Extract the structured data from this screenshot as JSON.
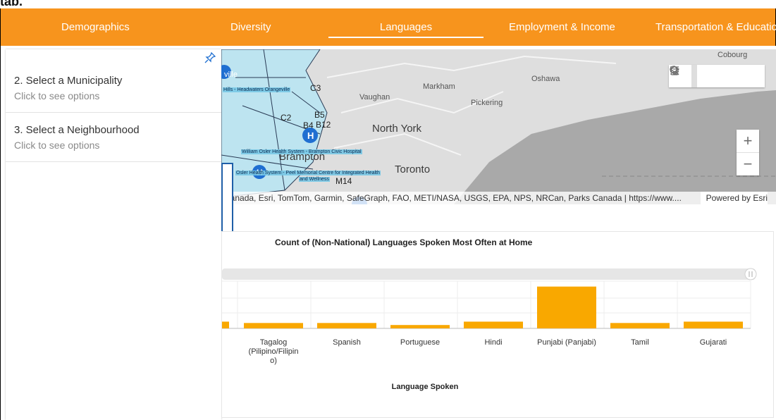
{
  "top_strip": {
    "text": "tab."
  },
  "tabs": [
    {
      "label": "Demographics",
      "active": false
    },
    {
      "label": "Diversity",
      "active": false
    },
    {
      "label": "Languages",
      "active": true
    },
    {
      "label": "Employment & Income",
      "active": false
    },
    {
      "label": "Transportation & Education",
      "active": false
    }
  ],
  "sidebar": {
    "items": [
      {
        "title": "2. Select a Municipality",
        "subtitle": "Click to see options"
      },
      {
        "title": "3. Select a Neighbourhood",
        "subtitle": "Click to see options"
      }
    ]
  },
  "map": {
    "labels": [
      "Cobourg",
      "Oshawa",
      "Markham",
      "Vaughan",
      "Pickering",
      "North York",
      "Toronto",
      "Brampton",
      "C3",
      "C2",
      "B5",
      "B4",
      "B12",
      "M14",
      "ville"
    ],
    "tiny_labels": [
      "Hills - Headwaters Orangeville",
      "William Osler Health System - Brampton Civic Hospital",
      "Osler Health System - Peel Memorial Centre for Integrated Health",
      "and Wellness"
    ],
    "attribution": "Canada, Esri, TomTom, Garmin, SafeGraph, FAO, METI/NASA, USGS, EPA, NPS, NRCan, Parks Canada | https://www....",
    "powered_by": "Powered by Esri",
    "zoom_in": "+",
    "zoom_out": "−",
    "colors": {
      "water": "#a9a9a9",
      "land": "#dedede",
      "region_fill": "#bde4f0",
      "marker": "#1f6fd1"
    },
    "tools": [
      "search-icon",
      "home-icon",
      "legend-list-icon",
      "layers-icon"
    ]
  },
  "chart_data": {
    "type": "bar",
    "title": "Count of (Non-National) Languages Spoken Most Often at Home",
    "xlabel": "Language Spoken",
    "ylabel": "",
    "categories": [
      "Tagalog (Pilipino/Filipino)",
      "Spanish",
      "Portuguese",
      "Hindi",
      "Punjabi (Panjabi)",
      "Tamil",
      "Gujarati"
    ],
    "category_lines": [
      [
        "Tagalog",
        "(Pilipino/Filipin",
        "o)"
      ],
      [
        "Spanish"
      ],
      [
        "Portuguese"
      ],
      [
        "Hindi"
      ],
      [
        "Punjabi (Panjabi)"
      ],
      [
        "Tamil"
      ],
      [
        "Gujarati"
      ]
    ],
    "values": [
      8,
      8,
      5,
      10,
      62,
      8,
      10
    ],
    "ylim": [
      0,
      70
    ],
    "grid": true,
    "bar_color": "#f9a800",
    "partial_bar_left": 10
  }
}
